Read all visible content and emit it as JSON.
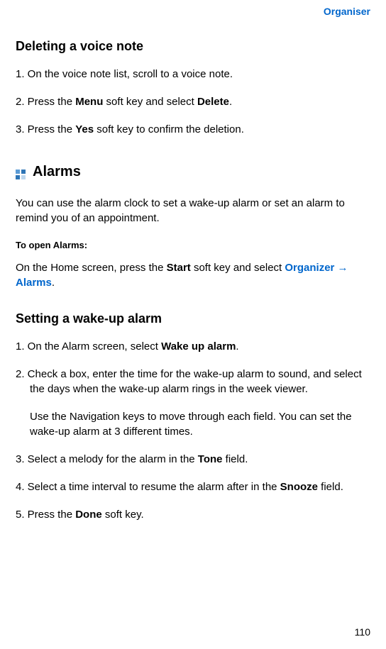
{
  "header": {
    "label": "Organiser"
  },
  "section1": {
    "title": "Deleting a voice note",
    "steps": [
      "1. On the voice note list, scroll to a voice note.",
      "2. Press the <b>Menu</b> soft key and select <b>Delete</b>.",
      "3. Press the <b>Yes</b> soft key to confirm the deletion."
    ]
  },
  "section2": {
    "name": "Alarms",
    "intro": "You can use the alarm clock to set a wake-up alarm or set an alarm to remind you of an appointment.",
    "sub_heading": "To open Alarms:",
    "sub_body_prefix": "On the Home screen, press the <b>Start</b> soft key and select ",
    "menu_path": "Organizer → Alarms",
    "sub_body_suffix": "."
  },
  "section3": {
    "title": "Setting a wake-up alarm",
    "steps": [
      "1. On the Alarm screen, select <b>Wake up alarm</b>.",
      "2. Check a box, enter the time for the wake-up alarm to sound, and select the days when the wake-up alarm rings in the week viewer.",
      "Use the Navigation keys to move through each field. You can set the wake-up alarm at 3 different times.",
      "3. Select a melody for the alarm in the <b>Tone</b> field.",
      "4. Select a time interval to resume the alarm after in the <b>Snooze</b> field.",
      "5. Press the <b>Done</b> soft key."
    ]
  },
  "page_number": "110"
}
